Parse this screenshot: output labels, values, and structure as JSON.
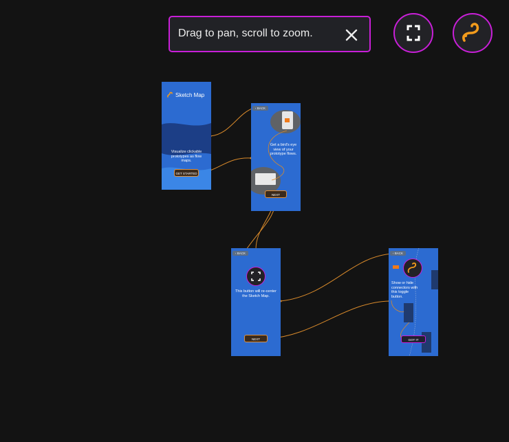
{
  "hint": {
    "text": "Drag to pan, scroll to zoom."
  },
  "controls": {
    "close_icon": "close-icon",
    "recenter_icon": "fullscreen-corners-icon",
    "toggle_icon": "squiggle-connector-icon"
  },
  "colors": {
    "background": "#131313",
    "accent_border": "#c91fd8",
    "connector": "#d98a2b",
    "board_blue": "#2c6bd1",
    "toggle_orange": "#f29b1c"
  },
  "boards": [
    {
      "title": "Sketch Map",
      "body": "Visualize clickable prototypes as flow maps.",
      "button": "GET STARTED"
    },
    {
      "back": "BACK",
      "body": "Get a bird's eye view of your prototype flows.",
      "button": "NEXT"
    },
    {
      "back": "BACK",
      "body": "This button will re-center the Sketch Map.",
      "button": "NEXT"
    },
    {
      "back": "BACK",
      "body": "Show or hide connectors with this toggle button.",
      "button": "GOT IT"
    }
  ]
}
